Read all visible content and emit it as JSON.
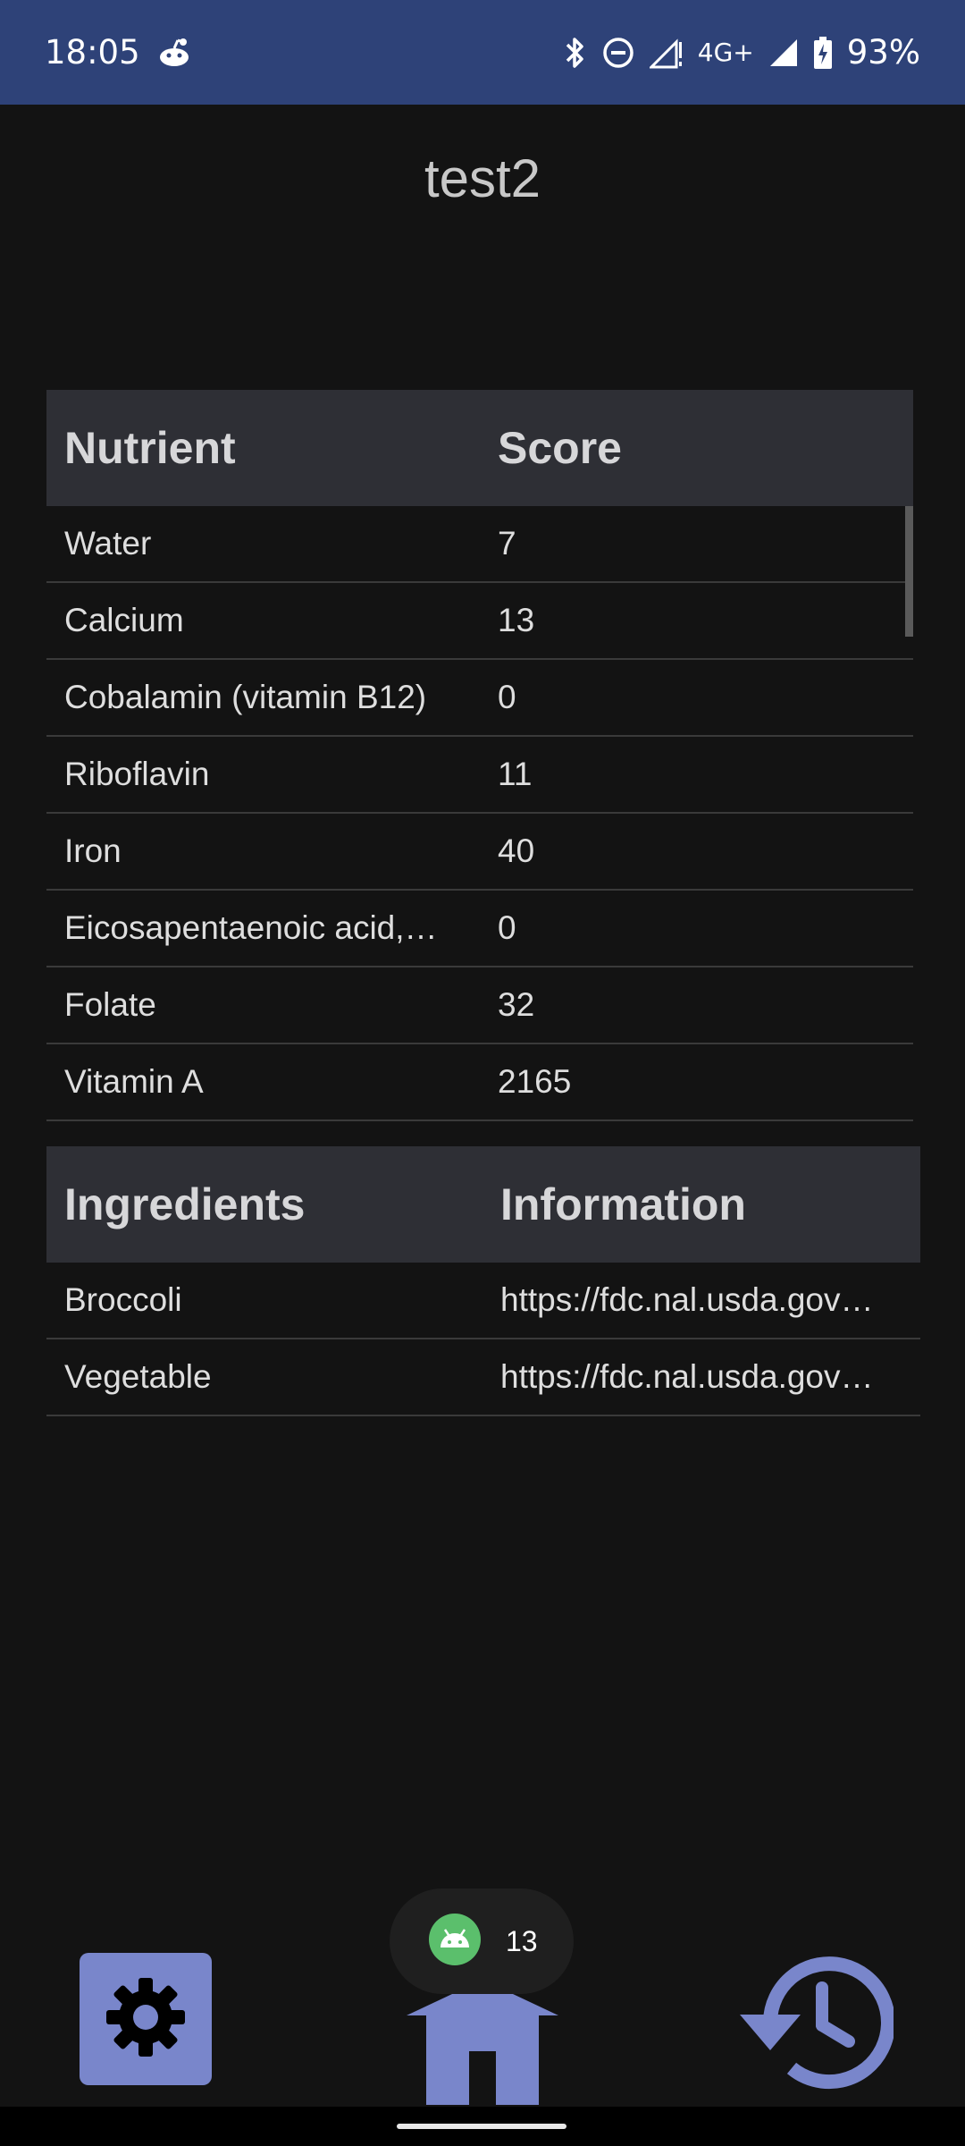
{
  "status_bar": {
    "time": "18:05",
    "network": "4G+",
    "battery": "93%",
    "icons": [
      "reddit-icon",
      "bluetooth-icon",
      "do-not-disturb-icon",
      "signal-icon",
      "battery-charging-icon"
    ]
  },
  "page": {
    "title": "test2"
  },
  "nutrients": {
    "header": {
      "col1": "Nutrient",
      "col2": "Score"
    },
    "rows": [
      {
        "name": "Water",
        "score": "7"
      },
      {
        "name": "Calcium",
        "score": "13"
      },
      {
        "name": "Cobalamin (vitamin B12)",
        "score": "0"
      },
      {
        "name": "Riboflavin",
        "score": "11"
      },
      {
        "name": "Iron",
        "score": "40"
      },
      {
        "name": "Eicosapentaenoic acid,…",
        "score": "0"
      },
      {
        "name": "Folate",
        "score": "32"
      },
      {
        "name": "Vitamin A",
        "score": "2165"
      }
    ]
  },
  "ingredients": {
    "header": {
      "col1": "Ingredients",
      "col2": "Information"
    },
    "rows": [
      {
        "name": "Broccoli",
        "info": "https://fdc.nal.usda.gov…"
      },
      {
        "name": "Vegetable",
        "info": "https://fdc.nal.usda.gov…"
      }
    ]
  },
  "toast": {
    "text": "13",
    "icon": "android-icon"
  },
  "nav": {
    "icons": [
      "settings-icon",
      "home-icon",
      "history-icon"
    ],
    "accent": "#7986cb"
  },
  "colors": {
    "status_bar": "#2e4278",
    "background": "#131313",
    "table_header": "#2e2f35"
  }
}
